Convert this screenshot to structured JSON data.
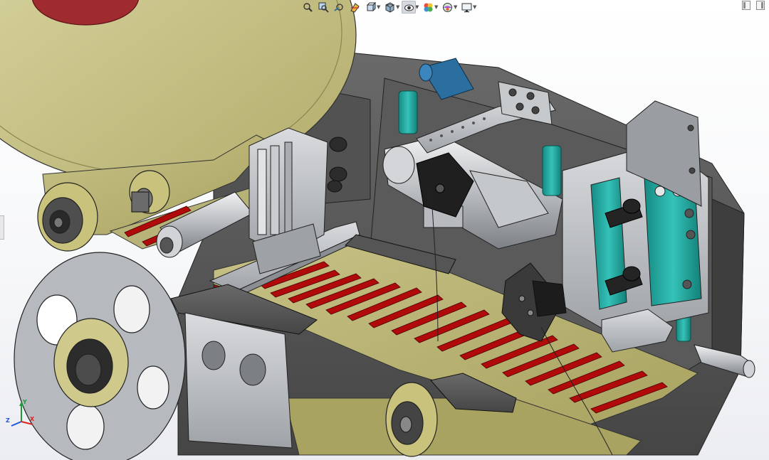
{
  "heads_up_toolbar": {
    "tools": [
      {
        "name": "zoom-to-fit-icon"
      },
      {
        "name": "zoom-to-area-icon"
      },
      {
        "name": "previous-view-icon"
      },
      {
        "name": "section-view-icon"
      },
      {
        "name": "view-orientation-icon",
        "has_menu": true
      },
      {
        "name": "display-style-icon",
        "has_menu": true
      },
      {
        "name": "hide-show-items-icon",
        "has_menu": true,
        "pressed": true
      },
      {
        "name": "edit-appearance-icon",
        "has_menu": true
      },
      {
        "name": "apply-scene-icon",
        "has_menu": true
      },
      {
        "name": "view-settings-icon",
        "has_menu": true
      }
    ]
  },
  "window_controls": [
    "restore-left-icon",
    "restore-right-icon"
  ],
  "triad": {
    "x": "X",
    "y": "Y",
    "z": "Z"
  },
  "colors": {
    "tape": "#b9b473",
    "labels": "#b10a0a",
    "frame": "#5e5e5e",
    "metal": "#b4b7bb",
    "teal": "#1fa39b",
    "blue_fitting": "#2a6fa0"
  }
}
